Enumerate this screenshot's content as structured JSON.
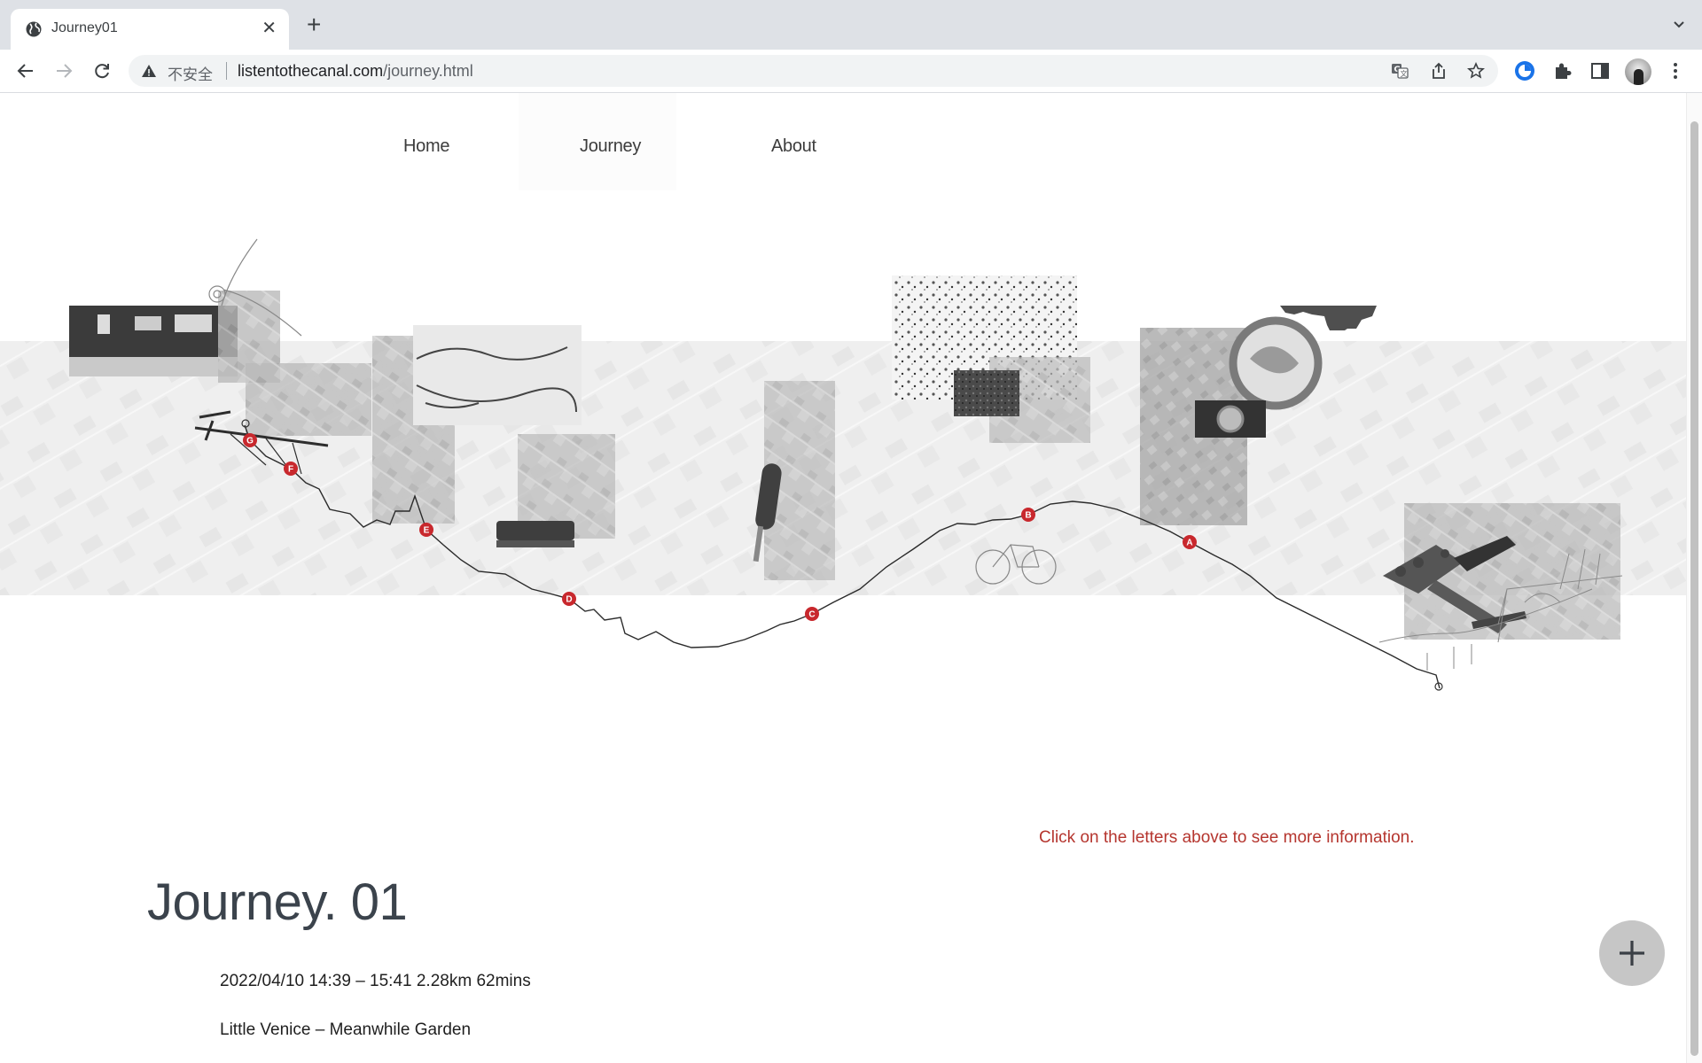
{
  "browser": {
    "tab": {
      "title": "Journey01",
      "favicon": "globe-icon",
      "close_icon": "close-icon"
    },
    "new_tab_icon": "plus-icon",
    "tab_list_icon": "chevron-down-icon",
    "toolbar": {
      "back_icon": "arrow-left-icon",
      "forward_icon": "arrow-right-icon",
      "reload_icon": "reload-icon",
      "security_warning": "不安全",
      "url_host": "listentothecanal.com",
      "url_path": "/journey.html",
      "omnibox_icons": [
        "translate-icon",
        "share-icon",
        "star-icon"
      ],
      "extension_icons": [
        "extension-globe-icon",
        "puzzle-icon",
        "side-panel-icon",
        "avatar-icon",
        "kebab-menu-icon"
      ]
    }
  },
  "site": {
    "nav": [
      {
        "label": "Home",
        "active": false
      },
      {
        "label": "Journey",
        "active": true
      },
      {
        "label": "About",
        "active": false
      }
    ]
  },
  "map": {
    "marker_color": "#c8282d",
    "markers": [
      {
        "letter": "G"
      },
      {
        "letter": "F"
      },
      {
        "letter": "E"
      },
      {
        "letter": "D"
      },
      {
        "letter": "C"
      },
      {
        "letter": "B"
      },
      {
        "letter": "A"
      }
    ],
    "prompt": "Click on the letters above to see more information."
  },
  "journey": {
    "title": "Journey. 01",
    "datetime_distance": "2022/04/10 14:39 – 15:41 2.28km 62mins",
    "route": "Little Venice – Meanwhile Garden"
  },
  "fab": {
    "icon": "plus-icon"
  }
}
